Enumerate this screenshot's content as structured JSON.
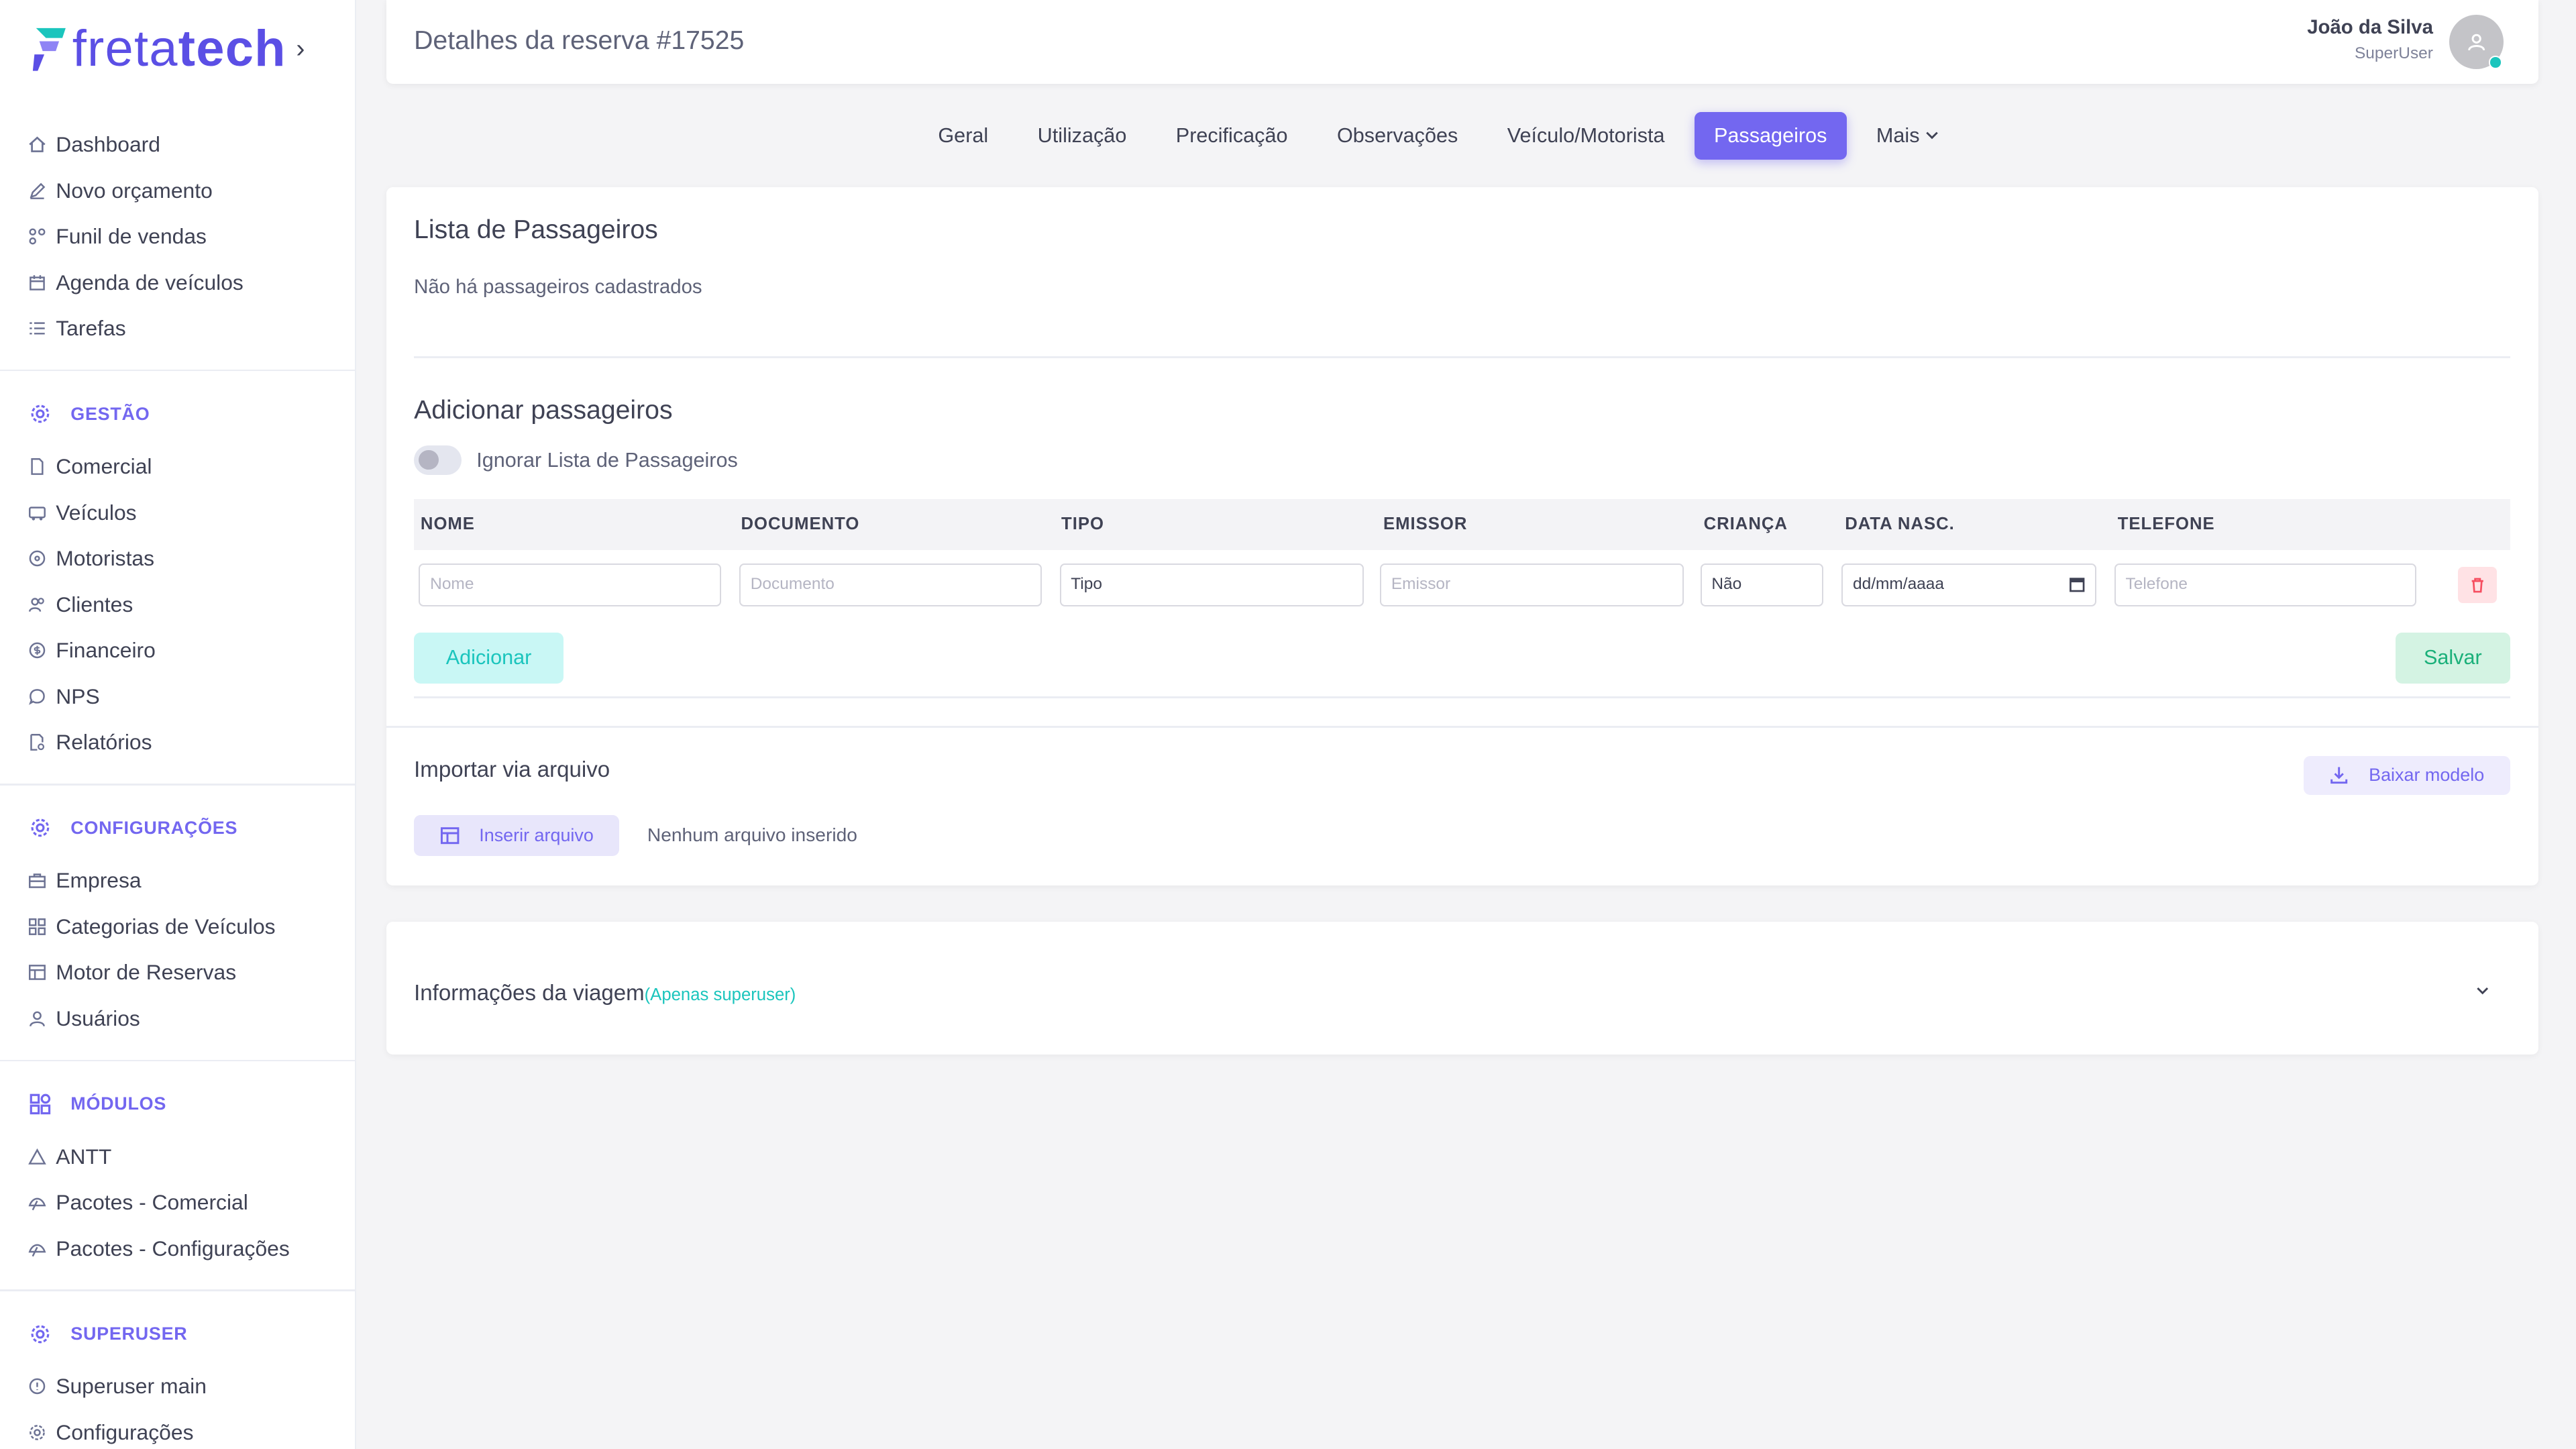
{
  "sidebar": {
    "logo": {
      "text_light": "freta",
      "text_bold": "tech",
      "chevron": "›"
    },
    "main_items": [
      {
        "label": "Dashboard",
        "icon": "home-icon"
      },
      {
        "label": "Novo orçamento",
        "icon": "edit-icon"
      },
      {
        "label": "Funil de vendas",
        "icon": "funnel-icon"
      },
      {
        "label": "Agenda de veículos",
        "icon": "calendar-icon"
      },
      {
        "label": "Tarefas",
        "icon": "list-icon"
      }
    ],
    "sections": [
      {
        "title": "GESTÃO",
        "items": [
          "Comercial",
          "Veículos",
          "Motoristas",
          "Clientes",
          "Financeiro",
          "NPS",
          "Relatórios"
        ]
      },
      {
        "title": "CONFIGURAÇÕES",
        "items": [
          "Empresa",
          "Categorias de Veículos",
          "Motor de Reservas",
          "Usuários"
        ]
      },
      {
        "title": "MÓDULOS",
        "items": [
          "ANTT",
          "Pacotes - Comercial",
          "Pacotes - Configurações"
        ]
      },
      {
        "title": "SUPERUSER",
        "items": [
          "Superuser main",
          "Configurações"
        ]
      }
    ]
  },
  "header": {
    "title": "Detalhes da reserva #17525",
    "user_name": "João da Silva",
    "user_role": "SuperUser"
  },
  "tabs": [
    {
      "label": "Geral",
      "active": false
    },
    {
      "label": "Utilização",
      "active": false
    },
    {
      "label": "Precificação",
      "active": false
    },
    {
      "label": "Observações",
      "active": false
    },
    {
      "label": "Veículo/Motorista",
      "active": false
    },
    {
      "label": "Passageiros",
      "active": true
    },
    {
      "label": "Mais",
      "active": false
    }
  ],
  "passengers": {
    "list_title": "Lista de Passageiros",
    "empty_text": "Não há passageiros cadastrados",
    "add_title": "Adicionar passageiros",
    "ignore_toggle_label": "Ignorar Lista de Passageiros",
    "columns": [
      "NOME",
      "DOCUMENTO",
      "TIPO",
      "EMISSOR",
      "CRIANÇA",
      "DATA NASC.",
      "TELEFONE"
    ],
    "form": {
      "nome_placeholder": "Nome",
      "documento_placeholder": "Documento",
      "tipo_value": "Tipo",
      "emissor_placeholder": "Emissor",
      "crianca_value": "Não",
      "data_value": "dd/mm/aaaa",
      "telefone_placeholder": "Telefone"
    },
    "add_button": "Adicionar",
    "save_button": "Salvar"
  },
  "import": {
    "title": "Importar via arquivo",
    "download_button": "Baixar modelo",
    "insert_button": "Inserir arquivo",
    "no_file_text": "Nenhum arquivo inserido"
  },
  "trip_info": {
    "title": "Informações da viagem",
    "badge": "(Apenas superuser)"
  },
  "colors": {
    "accent": "#7367f0",
    "success": "#1bc5bd",
    "danger": "#f64e60"
  }
}
